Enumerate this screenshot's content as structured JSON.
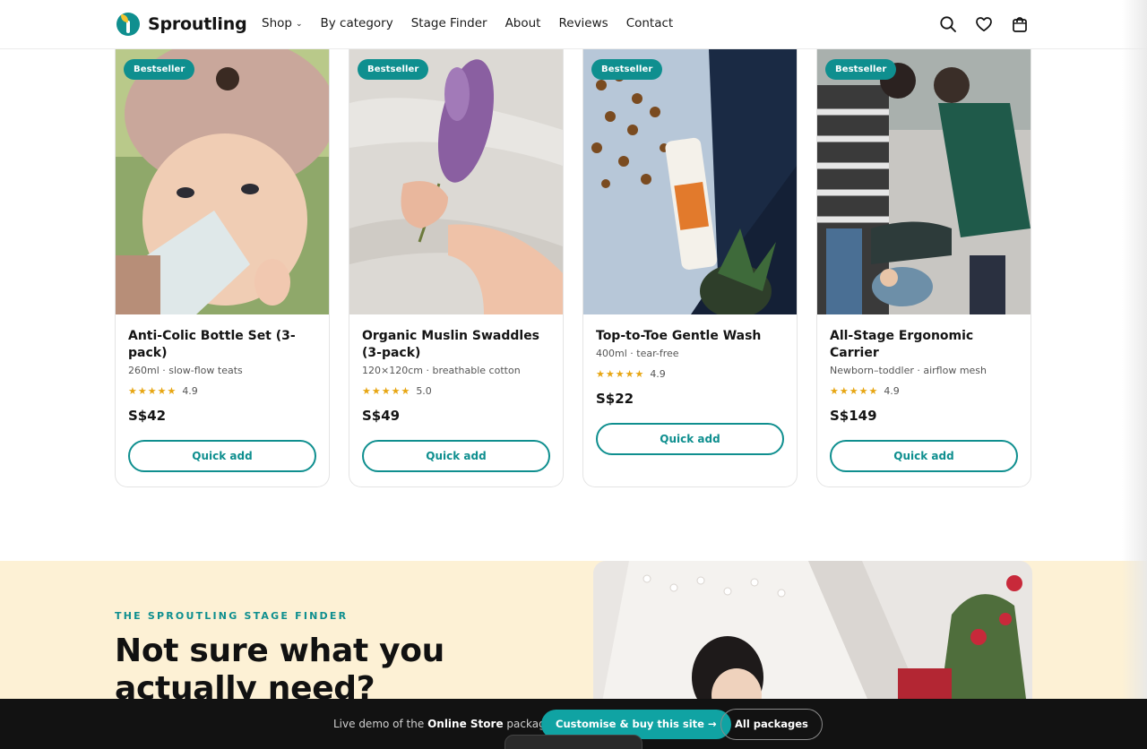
{
  "brand": {
    "name": "Sproutling"
  },
  "nav": {
    "items": [
      {
        "label": "Shop",
        "dropdown": true
      },
      {
        "label": "By category"
      },
      {
        "label": "Stage Finder"
      },
      {
        "label": "About"
      },
      {
        "label": "Reviews"
      },
      {
        "label": "Contact"
      }
    ],
    "icons": [
      "search-icon",
      "heart-icon",
      "bag-icon"
    ]
  },
  "products": [
    {
      "badge": "Bestseller",
      "name": "Anti-Colic Bottle Set (3-pack)",
      "sub": "260ml · slow-flow teats",
      "stars": "★★★★★",
      "rating": "4.9",
      "price": "S$42",
      "cta": "Quick add"
    },
    {
      "badge": "Bestseller",
      "name": "Organic Muslin Swaddles (3-pack)",
      "sub": "120×120cm · breathable cotton",
      "stars": "★★★★★",
      "rating": "5.0",
      "price": "S$49",
      "cta": "Quick add"
    },
    {
      "badge": "Bestseller",
      "name": "Top-to-Toe Gentle Wash",
      "sub": "400ml · tear-free",
      "stars": "★★★★★",
      "rating": "4.9",
      "price": "S$22",
      "cta": "Quick add"
    },
    {
      "badge": "Bestseller",
      "name": "All-Stage Ergonomic Carrier",
      "sub": "Newborn–toddler · airflow mesh",
      "stars": "★★★★★",
      "rating": "4.9",
      "price": "S$149",
      "cta": "Quick add"
    }
  ],
  "finder": {
    "eyebrow": "THE SPROUTLING STAGE FINDER",
    "title": "Not sure what you actually need?"
  },
  "demo_bar": {
    "text_prefix": "Live demo of the",
    "package": "Online Store",
    "text_suffix": "package.",
    "primary_cta": "Customise & buy this site →",
    "secondary_cta": "All packages"
  },
  "colors": {
    "accent": "#0f8f8f",
    "star": "#e7a613",
    "cream": "#fdf1d5",
    "bar": "#121212"
  }
}
